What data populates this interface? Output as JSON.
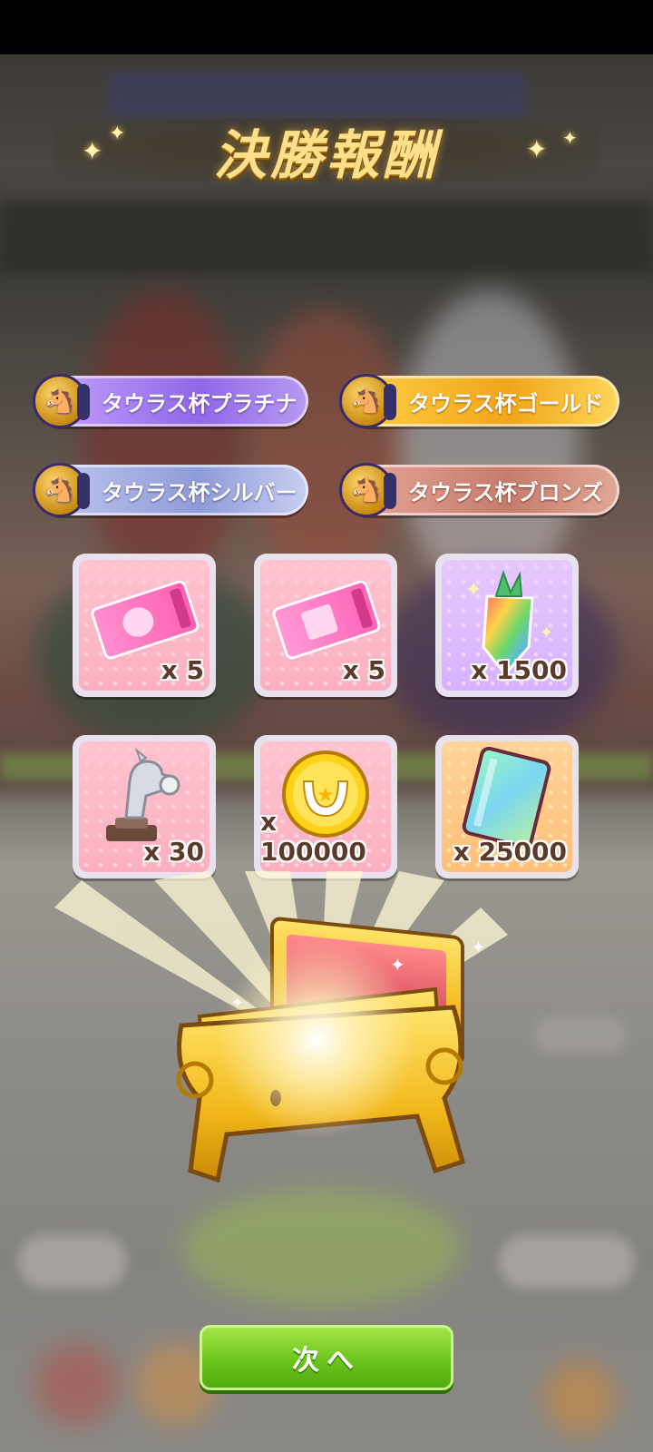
{
  "title": "決勝報酬",
  "badges": [
    {
      "label": "タウラス杯プラチナ",
      "tier": "platinum"
    },
    {
      "label": "タウラス杯ゴールド",
      "tier": "gold"
    },
    {
      "label": "タウラス杯シルバー",
      "tier": "silver"
    },
    {
      "label": "タウラス杯ブロンズ",
      "tier": "bronze"
    }
  ],
  "rewards": [
    {
      "icon": "pink-ticket-icon",
      "quantity": "x 5"
    },
    {
      "icon": "pink-photo-ticket-icon",
      "quantity": "x 5"
    },
    {
      "icon": "rainbow-carrot-jewel-icon",
      "quantity": "x 1500"
    },
    {
      "icon": "silver-horse-trophy-icon",
      "quantity": "x 30"
    },
    {
      "icon": "horseshoe-coin-icon",
      "quantity": "x 100000"
    },
    {
      "icon": "rainbow-card-icon",
      "quantity": "x 25000"
    }
  ],
  "next_button": {
    "label": "次へ"
  },
  "colors": {
    "platinum": "#9b74ec",
    "gold": "#f3ac22",
    "silver": "#98a3dc",
    "bronze": "#c98272",
    "next_button": "#6cc51c"
  }
}
